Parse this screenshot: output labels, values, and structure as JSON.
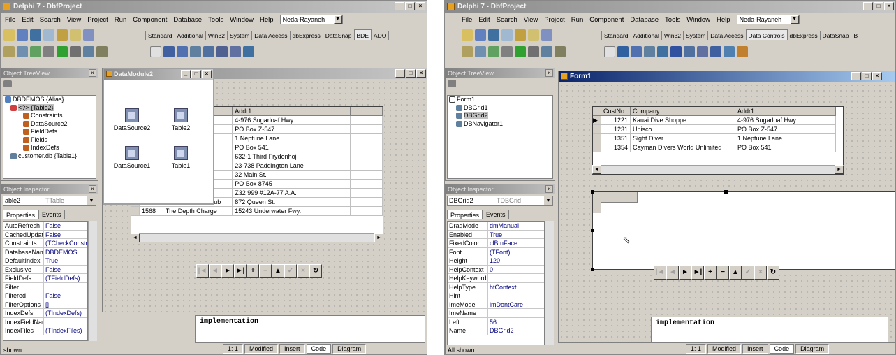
{
  "left": {
    "title": "Delphi 7 - DbfProject",
    "menu": [
      "File",
      "Edit",
      "Search",
      "View",
      "Project",
      "Run",
      "Component",
      "Database",
      "Tools",
      "Window",
      "Help"
    ],
    "desktop": "Neda-Rayaneh",
    "palette_tabs": [
      "Standard",
      "Additional",
      "Win32",
      "System",
      "Data Access",
      "dbExpress",
      "DataSnap",
      "BDE",
      "ADO"
    ],
    "treeview": {
      "title": "Object TreeView",
      "items": [
        "DBDEMOS {Alias}",
        "<?> {Table2}",
        "Constraints",
        "DataSource2",
        "FieldDefs",
        "Fields",
        "IndexDefs",
        "customer.db {Table1}"
      ]
    },
    "inspector": {
      "title": "Object Inspector",
      "object": "able2",
      "type": "TTable",
      "tabs": [
        "Properties",
        "Events"
      ],
      "props": [
        [
          "AutoRefresh",
          "False"
        ],
        [
          "CachedUpdates",
          "False"
        ],
        [
          "Constraints",
          "(TCheckConstra"
        ],
        [
          "DatabaseName",
          "DBDEMOS"
        ],
        [
          "DefaultIndex",
          "True"
        ],
        [
          "Exclusive",
          "False"
        ],
        [
          "FieldDefs",
          "(TFieldDefs)"
        ],
        [
          "Filter",
          ""
        ],
        [
          "Filtered",
          "False"
        ],
        [
          "FilterOptions",
          "[]"
        ],
        [
          "IndexDefs",
          "(TIndexDefs)"
        ],
        [
          "IndexFieldNam",
          ""
        ],
        [
          "IndexFiles",
          "(TIndexFiles)"
        ]
      ],
      "status": "shown"
    },
    "datamodule": {
      "title": "DataModule2",
      "comps": [
        "DataSource2",
        "Table2",
        "DataSource1",
        "Table1"
      ]
    },
    "grid": {
      "col": "Addr1",
      "rows": [
        [
          "",
          "ppe",
          "4-976 Sugarloaf Hwy"
        ],
        [
          "",
          "",
          "PO Box Z-547"
        ],
        [
          "",
          "",
          "1 Neptune Lane"
        ],
        [
          "",
          "orld Unlimited",
          "PO Box 541"
        ],
        [
          "",
          "ing Centre",
          "632-1 Third Frydenhoj"
        ],
        [
          "",
          "Center",
          "23-738 Paddington Lane"
        ],
        [
          "",
          "",
          "32 Main St."
        ],
        [
          "",
          "",
          "PO Box 8745"
        ],
        [
          "",
          "",
          "Z32 999 #12A-77 A.A."
        ],
        [
          "1551",
          "Marmot Divers Club",
          "872 Queen St."
        ],
        [
          "1568",
          "The Depth Charge",
          "15243 Underwater Fwy."
        ]
      ]
    },
    "editor": "implementation",
    "statusbar": [
      "1:  1",
      "Modified",
      "Insert"
    ],
    "bottom_tabs": [
      "Code",
      "Diagram"
    ]
  },
  "right": {
    "title": "Delphi 7 - DbfProject",
    "menu": [
      "File",
      "Edit",
      "Search",
      "View",
      "Project",
      "Run",
      "Component",
      "Database",
      "Tools",
      "Window",
      "Help"
    ],
    "desktop": "Neda-Rayaneh",
    "palette_tabs": [
      "Standard",
      "Additional",
      "Win32",
      "System",
      "Data Access",
      "Data Controls",
      "dbExpress",
      "DataSnap",
      "B"
    ],
    "treeview": {
      "title": "Object TreeView",
      "items": [
        "Form1",
        "DBGrid1",
        "DBGrid2",
        "DBNavigator1"
      ]
    },
    "inspector": {
      "title": "Object Inspector",
      "object": "DBGrid2",
      "type": "TDBGrid",
      "tabs": [
        "Properties",
        "Events"
      ],
      "props": [
        [
          "DragMode",
          "dmManual"
        ],
        [
          "Enabled",
          "True"
        ],
        [
          "FixedColor",
          "clBtnFace"
        ],
        [
          "Font",
          "(TFont)"
        ],
        [
          "Height",
          "120"
        ],
        [
          "HelpContext",
          "0"
        ],
        [
          "HelpKeyword",
          ""
        ],
        [
          "HelpType",
          "htContext"
        ],
        [
          "Hint",
          ""
        ],
        [
          "ImeMode",
          "imDontCare"
        ],
        [
          "ImeName",
          ""
        ],
        [
          "Left",
          "56"
        ],
        [
          "Name",
          "DBGrid2"
        ]
      ],
      "status": "All shown"
    },
    "form": {
      "title": "Form1"
    },
    "grid": {
      "cols": [
        "CustNo",
        "Company",
        "Addr1"
      ],
      "rows": [
        [
          "1221",
          "Kauai Dive Shoppe",
          "4-976 Sugarloaf Hwy"
        ],
        [
          "1231",
          "Unisco",
          "PO Box Z-547"
        ],
        [
          "1351",
          "Sight Diver",
          "1 Neptune Lane"
        ],
        [
          "1354",
          "Cayman Divers World Unlimited",
          "PO Box 541"
        ]
      ]
    },
    "editor": "implementation",
    "statusbar": [
      "1:  1",
      "Modified",
      "Insert"
    ],
    "bottom_tabs": [
      "Code",
      "Diagram"
    ]
  }
}
